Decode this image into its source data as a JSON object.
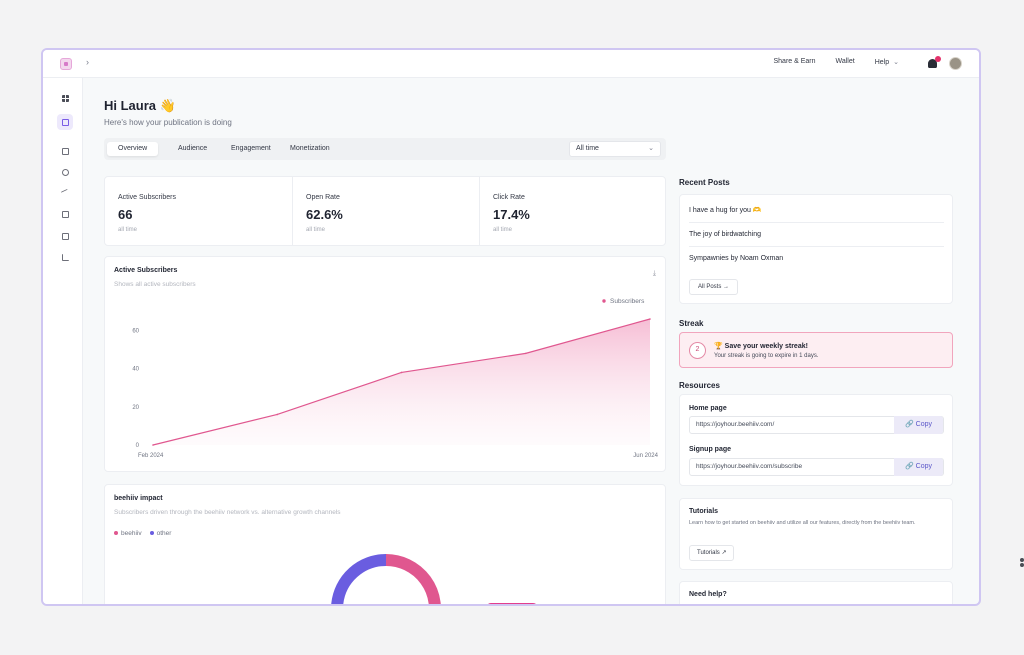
{
  "topbar": {
    "nav": [
      "Share & Earn",
      "Wallet",
      "Help"
    ]
  },
  "sidebar": {
    "icons": [
      "dashboard-icon",
      "edit-icon",
      "document-icon",
      "subscribers-icon",
      "growth-icon",
      "monetize-icon",
      "pages-icon",
      "analytics-icon"
    ]
  },
  "greeting": {
    "title": "Hi Laura 👋",
    "subtitle": "Here's how your publication is doing"
  },
  "tabs": [
    "Overview",
    "Audience",
    "Engagement",
    "Monetization"
  ],
  "range_select": "All time",
  "stats": [
    {
      "label": "Active Subscribers",
      "value": "66",
      "period": "all time"
    },
    {
      "label": "Open Rate",
      "value": "62.6%",
      "period": "all time"
    },
    {
      "label": "Click Rate",
      "value": "17.4%",
      "period": "all time"
    }
  ],
  "subscribers_chart": {
    "title": "Active Subscribers",
    "subtitle": "Shows all active subscribers"
  },
  "impact": {
    "title": "beehiiv impact",
    "subtitle": "Subscribers driven through the beehiiv network vs. alternative growth channels",
    "legend": [
      "beehiiv",
      "other"
    ]
  },
  "recent_posts": {
    "title": "Recent Posts",
    "posts": [
      "I have a hug for you 🫶",
      "The joy of birdwatching",
      "Sympawnies by Noam Oxman"
    ],
    "all_posts_label": "All Posts →"
  },
  "streak": {
    "title": "Streak",
    "badge": "2",
    "headline": "🏆 Save your weekly streak!",
    "message": "Your streak is going to expire in 1 days."
  },
  "resources": {
    "title": "Resources",
    "home_label": "Home page",
    "home_url": "https://joyhour.beehiiv.com/",
    "signup_label": "Signup page",
    "signup_url": "https://joyhour.beehiiv.com/subscribe",
    "copy_label": "🔗 Copy"
  },
  "tutorials": {
    "title": "Tutorials",
    "text": "Learn how to get started on beehiiv and utilize all our features, directly from the beehiiv team.",
    "button": "Tutorials ↗"
  },
  "help": {
    "title": "Need help?"
  },
  "colors": {
    "accent": "#e0578f",
    "purple": "#6a5de0",
    "streak_bg": "#fdeef2"
  },
  "chart_data": [
    {
      "type": "area",
      "title": "Active Subscribers",
      "series": [
        {
          "name": "Subscribers",
          "points": [
            [
              "Feb 2024",
              0
            ],
            [
              "2024-04",
              16
            ],
            [
              "2024-06",
              38
            ],
            [
              "2024-08",
              48
            ],
            [
              "Jun 2024",
              66
            ]
          ]
        }
      ],
      "x_tick_labels": [
        "Feb 2024",
        "Jun 2024"
      ],
      "y_ticks": [
        0,
        20,
        40,
        60
      ],
      "ylim": [
        0,
        66
      ],
      "legend": "top-right"
    },
    {
      "type": "pie",
      "title": "beehiiv impact",
      "slices": [
        {
          "name": "beehiiv",
          "value": 0.3
        },
        {
          "name": "other",
          "value": 0.7
        }
      ]
    }
  ]
}
